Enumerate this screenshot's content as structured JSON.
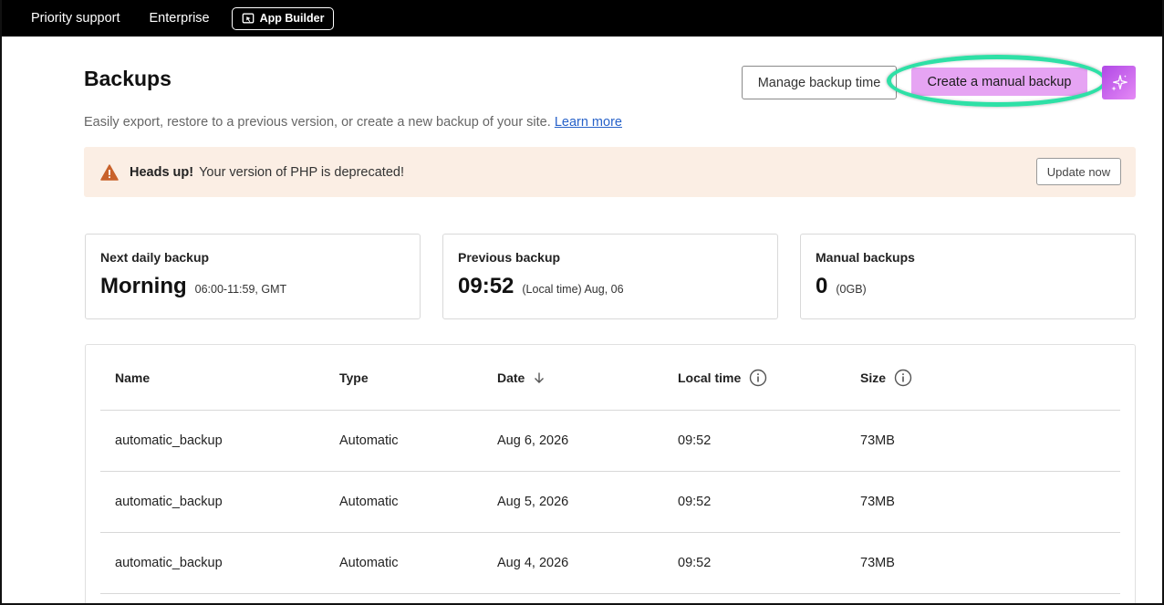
{
  "topbar": {
    "links": [
      "Priority support",
      "Enterprise"
    ],
    "app_builder_label": "App Builder"
  },
  "header": {
    "title": "Backups",
    "manage_button": "Manage backup time",
    "create_button": "Create a manual backup",
    "ai_button_icon": "sparkles-icon",
    "subtitle": "Easily export, restore to a previous version, or create a new backup of your site.",
    "learn_more": "Learn more"
  },
  "banner": {
    "icon": "warning-triangle-icon",
    "title": "Heads up!",
    "message": "Your version of PHP is deprecated!",
    "button": "Update now"
  },
  "cards": [
    {
      "label": "Next daily backup",
      "value": "Morning",
      "detail": "06:00-11:59, GMT"
    },
    {
      "label": "Previous backup",
      "value": "09:52",
      "detail": "(Local time) Aug, 06"
    },
    {
      "label": "Manual backups",
      "value": "0",
      "detail": "(0GB)"
    }
  ],
  "table": {
    "columns": [
      "Name",
      "Type",
      "Date",
      "Local time",
      "Size"
    ],
    "rows": [
      [
        "automatic_backup",
        "Automatic",
        "Aug 6, 2026",
        "09:52",
        "73MB"
      ],
      [
        "automatic_backup",
        "Automatic",
        "Aug 5, 2026",
        "09:52",
        "73MB"
      ],
      [
        "automatic_backup",
        "Automatic",
        "Aug 4, 2026",
        "09:52",
        "73MB"
      ]
    ]
  },
  "colors": {
    "accent_create": "#e6a4f3",
    "highlight_ring": "#2ee0a6",
    "link": "#2762c9",
    "banner_bg": "#fbeee4",
    "warning": "#c8612a"
  }
}
